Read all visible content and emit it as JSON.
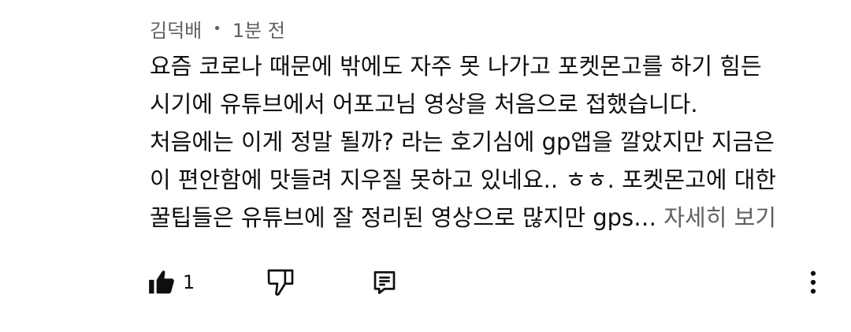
{
  "comment": {
    "author": "김덕배",
    "separator": "•",
    "time": "1분 전",
    "lines": [
      "요즘 코로나 때문에 밖에도 자주 못 나가고 포켓몬고를 하기 힘든",
      "시기에 유튜브에서 어포고님 영상을 처음으로 접했습니다.",
      "처음에는 이게 정말 될까?  라는 호기심에 gp앱을 깔았지만 지금은",
      "이 편안함에 맛들려 지우질 못하고 있네요.. ㅎㅎ. 포켓몬고에 대한",
      "꿀팁들은 유튜브에 잘 정리된 영상으로 많지만 gps… "
    ],
    "more_label": "자세히 보기"
  },
  "actions": {
    "like_icon": "thumbs-up-filled-icon",
    "like_count": "1",
    "dislike_icon": "thumbs-down-outline-icon",
    "reply_icon": "reply-comment-icon",
    "menu_icon": "more-vertical-icon"
  },
  "colors": {
    "text": "#0f0f0f",
    "secondary": "#606060",
    "background": "#ffffff"
  }
}
